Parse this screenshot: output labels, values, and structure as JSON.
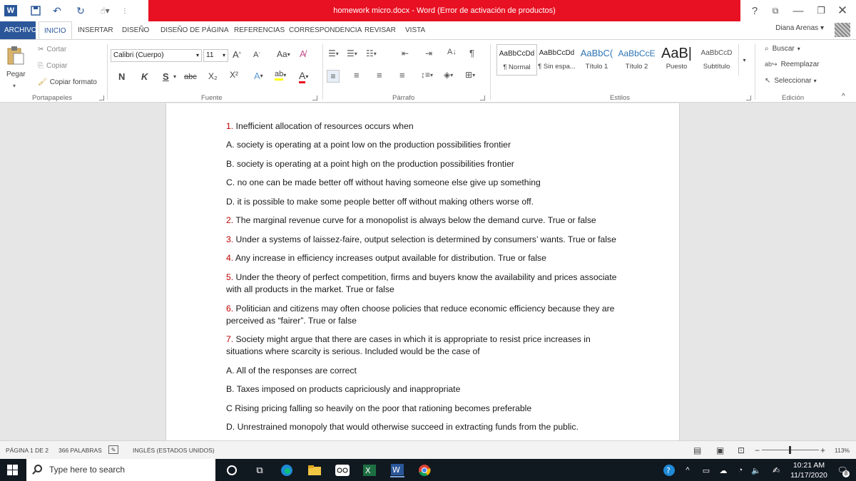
{
  "window": {
    "title": "homework micro.docx -  Word (Error de activación de productos)",
    "help": "?",
    "user_name": "Diana Arenas"
  },
  "tabs": [
    "ARCHIVO",
    "INICIO",
    "INSERTAR",
    "DISEÑO",
    "DISEÑO DE PÁGINA",
    "REFERENCIAS",
    "CORRESPONDENCIA",
    "REVISAR",
    "VISTA"
  ],
  "ribbon": {
    "clipboard": {
      "paste": "Pegar",
      "cut": "Cortar",
      "copy": "Copiar",
      "format_painter": "Copiar formato",
      "label": "Portapapeles"
    },
    "font": {
      "family": "Calibri (Cuerpo)",
      "size": "11",
      "bold": "N",
      "italic": "K",
      "underline": "S",
      "strike": "abc",
      "subscript": "X₂",
      "superscript": "X²",
      "aa": "Aa",
      "label": "Fuente"
    },
    "paragraph": {
      "label": "Párrafo"
    },
    "styles": {
      "items": [
        {
          "preview": "AaBbCcDd",
          "name": "¶ Normal"
        },
        {
          "preview": "AaBbCcDd",
          "name": "¶ Sin espa..."
        },
        {
          "preview": "AaBbC(",
          "name": "Título 1"
        },
        {
          "preview": "AaBbCcE",
          "name": "Título 2"
        },
        {
          "preview": "AaB|",
          "name": "Puesto"
        },
        {
          "preview": "AaBbCcD",
          "name": "Subtítulo"
        }
      ],
      "label": "Estilos"
    },
    "editing": {
      "find": "Buscar",
      "replace": "Reemplazar",
      "select": "Seleccionar",
      "label": "Edición"
    }
  },
  "document": {
    "lines": [
      {
        "num": "1.",
        "text": " Inefficient allocation of resources occurs when"
      },
      {
        "num": "",
        "text": "A. society is operating at a point low on the production possibilities frontier"
      },
      {
        "num": "",
        "text": "B. society is operating at a point high on the production possibilities frontier"
      },
      {
        "num": "",
        "text": "C. no one can be made better off without having someone else give up something"
      },
      {
        "num": "",
        "text": "D. it is possible to make some people better off without making others worse off."
      },
      {
        "num": "2.",
        "text": " The marginal revenue curve for a monopolist is always below the demand curve. True or false"
      },
      {
        "num": "3.",
        "text": " Under a systems of laissez-faire, output selection is determined by consumers’ wants. True or false"
      },
      {
        "num": "4.",
        "text": "  Any increase in efficiency increases output available for distribution. True or false"
      },
      {
        "num": "5.",
        "text": " Under the theory of perfect competition, firms and buyers know the availability and prices associate"
      },
      {
        "num": "",
        "text": "with all products in the market. True or false"
      },
      {
        "num": "6.",
        "text": " Politician and citizens may often choose policies that reduce economic efficiency because they are"
      },
      {
        "num": "",
        "text": "perceived as “fairer”. True or false"
      },
      {
        "num": "7.",
        "text": " Society might argue that there are cases in which it is appropriate to resist price increases in"
      },
      {
        "num": "",
        "text": "situations where scarcity is serious. Included would be the case of"
      },
      {
        "num": "",
        "text": "A. All of the responses are correct"
      },
      {
        "num": "",
        "text": "B. Taxes imposed on products capriciously and inappropriate"
      },
      {
        "num": "",
        "text": "C Rising pricing falling so heavily on the poor that rationing becomes preferable"
      },
      {
        "num": "",
        "text": "D. Unrestrained monopoly that would otherwise succeed in extracting funds from the public."
      }
    ]
  },
  "status": {
    "page": "PÁGINA 1 DE 2",
    "words": "366 PALABRAS",
    "language": "INGLÉS (ESTADOS UNIDOS)",
    "zoom": "113%",
    "zoom_minus": "−",
    "zoom_plus": "+"
  },
  "taskbar": {
    "search_placeholder": "Type here to search",
    "time": "10:21 AM",
    "date": "11/17/2020",
    "notification_count": "8"
  }
}
